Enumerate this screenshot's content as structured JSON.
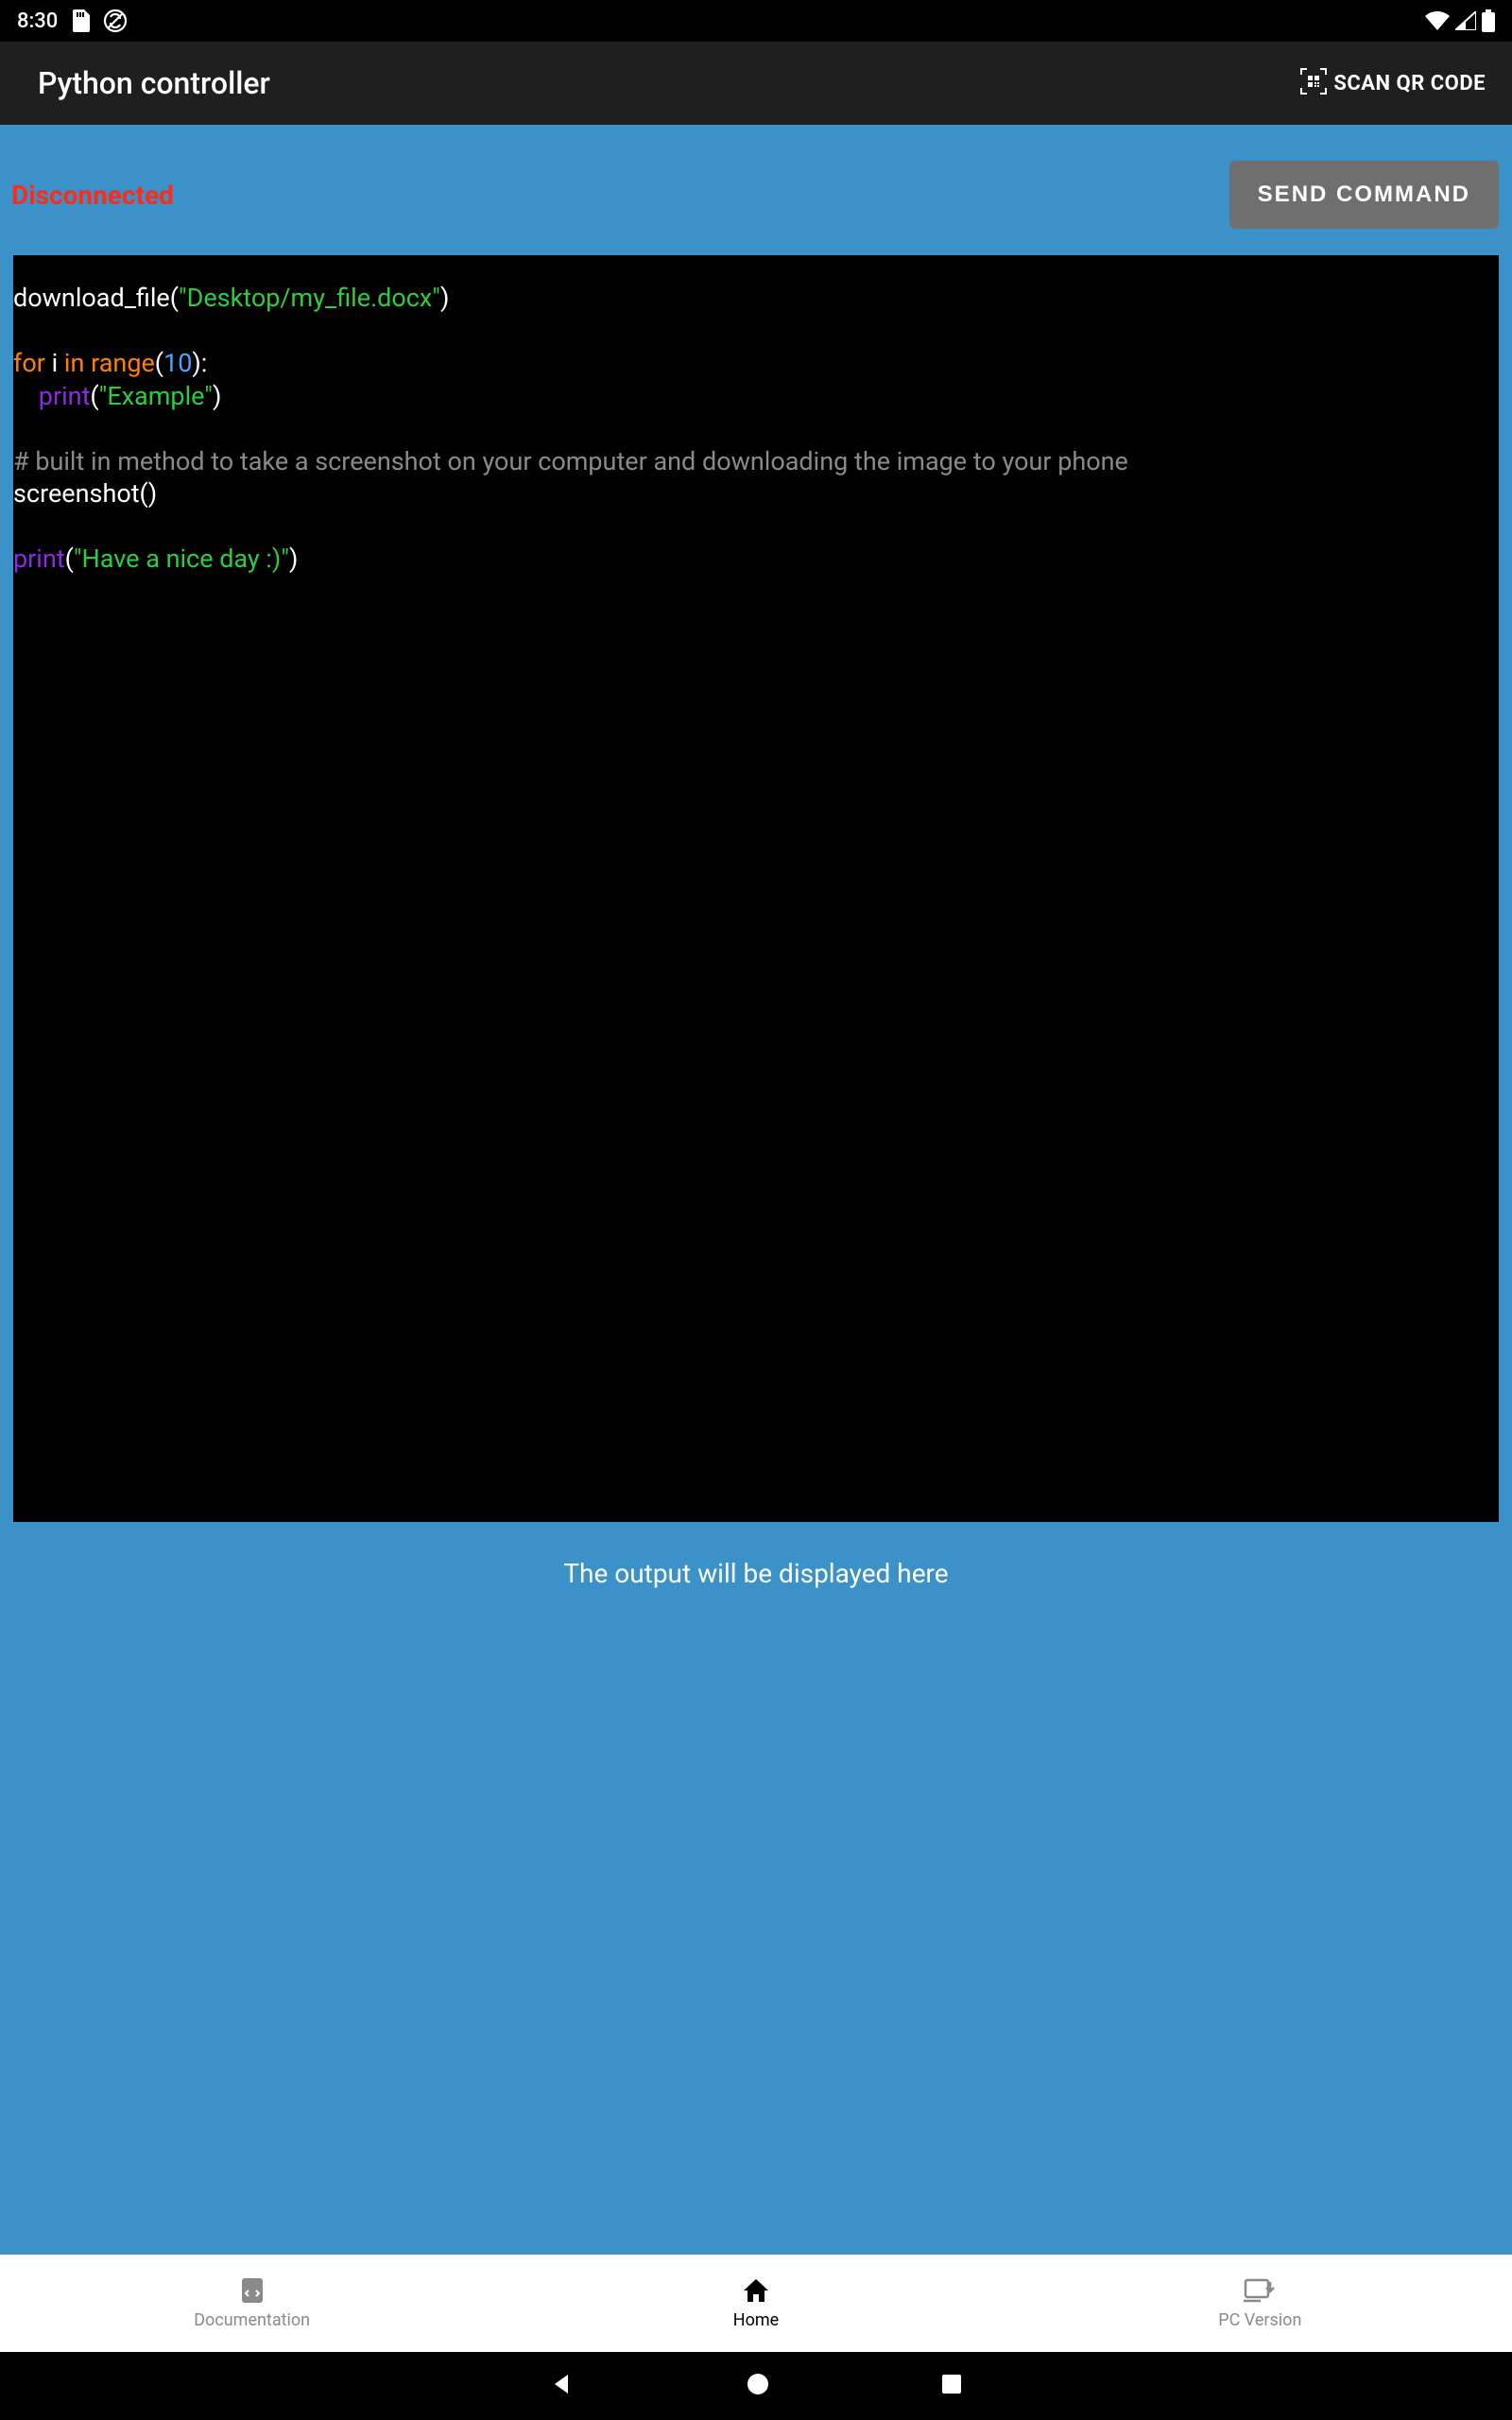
{
  "statusbar": {
    "time": "8:30"
  },
  "actionbar": {
    "title": "Python controller",
    "scan_label": "SCAN QR CODE"
  },
  "top": {
    "status": "Disconnected",
    "send_label": "SEND COMMAND"
  },
  "editor": {
    "code_tokens": [
      {
        "t": "download_file",
        "cls": "tok-fn"
      },
      {
        "t": "(",
        "cls": "tok-paren"
      },
      {
        "t": "\"Desktop/my_file.docx\"",
        "cls": "tok-str"
      },
      {
        "t": ")",
        "cls": "tok-paren"
      },
      {
        "t": "\n\n"
      },
      {
        "t": "for",
        "cls": "tok-kw"
      },
      {
        "t": " i "
      },
      {
        "t": "in",
        "cls": "tok-kw"
      },
      {
        "t": " "
      },
      {
        "t": "range",
        "cls": "tok-kw"
      },
      {
        "t": "(",
        "cls": "tok-paren"
      },
      {
        "t": "10",
        "cls": "tok-num"
      },
      {
        "t": "):",
        "cls": "tok-paren"
      },
      {
        "t": "\n    "
      },
      {
        "t": "print",
        "cls": "tok-builtin"
      },
      {
        "t": "(",
        "cls": "tok-paren"
      },
      {
        "t": "\"Example\"",
        "cls": "tok-str"
      },
      {
        "t": ")",
        "cls": "tok-paren"
      },
      {
        "t": "\n\n"
      },
      {
        "t": "# built in method to take a screenshot on your computer and downloading the image to your phone",
        "cls": "tok-comment"
      },
      {
        "t": "\n"
      },
      {
        "t": "screenshot()",
        "cls": "tok-fn"
      },
      {
        "t": "\n\n"
      },
      {
        "t": "print",
        "cls": "tok-builtin"
      },
      {
        "t": "(",
        "cls": "tok-paren"
      },
      {
        "t": "\"Have a nice day :)\"",
        "cls": "tok-str"
      },
      {
        "t": ")",
        "cls": "tok-paren"
      }
    ]
  },
  "output": {
    "placeholder": "The output will be displayed here"
  },
  "nav": {
    "doc": "Documentation",
    "home": "Home",
    "pc": "PC Version"
  }
}
